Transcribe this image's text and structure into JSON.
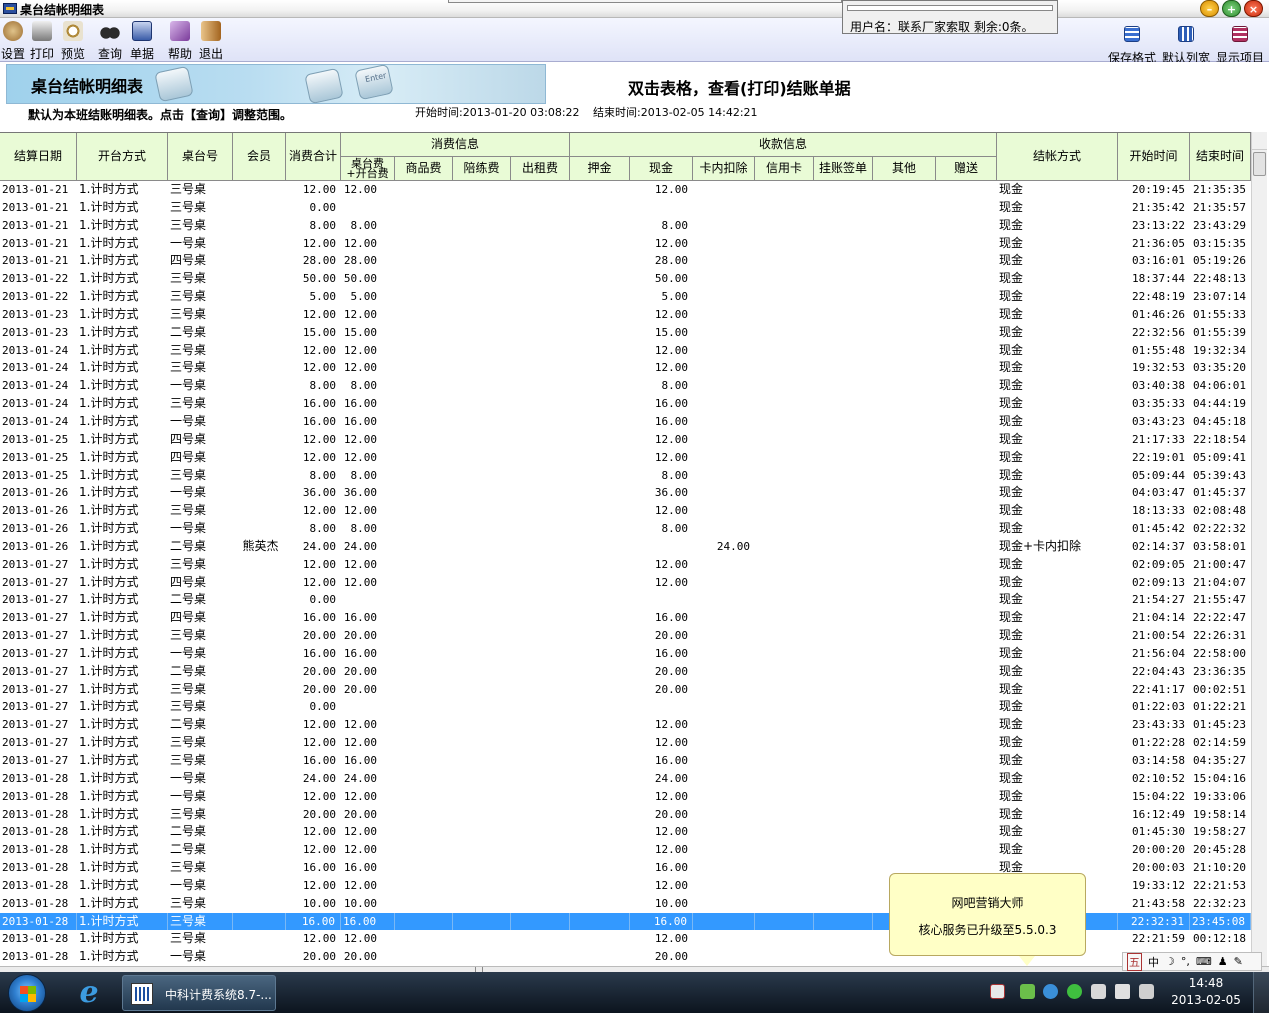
{
  "window": {
    "title": "桌台结帐明细表"
  },
  "user_panel": {
    "text": "用户名：联系厂家索取 剩余:0条。"
  },
  "toolbar": {
    "left": [
      {
        "id": "settings",
        "label": "设置",
        "icon": "gear-icon",
        "color": "#9a6b2f"
      },
      {
        "id": "print",
        "label": "打印",
        "icon": "printer-icon",
        "color": "#7a7a7a"
      },
      {
        "id": "preview",
        "label": "预览",
        "icon": "magnifier-icon",
        "color": "#b08a3a"
      },
      {
        "id": "query",
        "label": "查询",
        "icon": "binoculars-icon",
        "color": "#2b2b2b"
      },
      {
        "id": "bill",
        "label": "单据",
        "icon": "document-icon",
        "color": "#3a5ca8"
      },
      {
        "id": "help",
        "label": "帮助",
        "icon": "book-icon",
        "color": "#7a3a9a"
      },
      {
        "id": "exit",
        "label": "退出",
        "icon": "exit-door-icon",
        "color": "#a3641f"
      }
    ],
    "right": [
      {
        "id": "save-format",
        "label": "保存格式",
        "icon": "save-grid-icon",
        "color": "#3a6fd0"
      },
      {
        "id": "default-width",
        "label": "默认列宽",
        "icon": "columns-icon",
        "color": "#2f5fb8"
      },
      {
        "id": "show-items",
        "label": "显示项目",
        "icon": "list-icon",
        "color": "#b03060"
      }
    ]
  },
  "banner": {
    "title": "桌台结帐明细表",
    "keycap": "Enter",
    "headline": "双击表格，查看(打印)结账单据",
    "default_note": "默认为本班结账明细表。点击【查询】调整范围。",
    "start_time": "开始时间:2013-01-20 03:08:22",
    "end_time": "结束时间:2013-02-05 14:42:21"
  },
  "table": {
    "headers": {
      "date": "结算日期",
      "mode": "开台方式",
      "table": "桌台号",
      "member": "会员",
      "total": "消费合计",
      "consume_group": "消费信息",
      "table_fee": "桌台费+开台费",
      "goods": "商品费",
      "companion": "陪练费",
      "rent": "出租费",
      "receipt_group": "收款信息",
      "deposit": "押金",
      "cash": "现金",
      "card_deduct": "卡内扣除",
      "credit": "信用卡",
      "charge": "挂账签单",
      "other": "其他",
      "gift": "赠送",
      "settle": "结帐方式",
      "start": "开始时间",
      "end": "结束时间"
    },
    "rows": [
      [
        "2013-01-21",
        "1.计时方式",
        "三号桌",
        "",
        "12.00",
        "12.00",
        "",
        "",
        "",
        "",
        "12.00",
        "",
        "",
        "",
        "",
        "",
        "现金",
        "20:19:45",
        "21:35:35"
      ],
      [
        "2013-01-21",
        "1.计时方式",
        "三号桌",
        "",
        "0.00",
        "",
        "",
        "",
        "",
        "",
        "",
        "",
        "",
        "",
        "",
        "",
        "现金",
        "21:35:42",
        "21:35:57"
      ],
      [
        "2013-01-21",
        "1.计时方式",
        "三号桌",
        "",
        "8.00",
        "8.00",
        "",
        "",
        "",
        "",
        "8.00",
        "",
        "",
        "",
        "",
        "",
        "现金",
        "23:13:22",
        "23:43:29"
      ],
      [
        "2013-01-21",
        "1.计时方式",
        "一号桌",
        "",
        "12.00",
        "12.00",
        "",
        "",
        "",
        "",
        "12.00",
        "",
        "",
        "",
        "",
        "",
        "现金",
        "21:36:05",
        "03:15:35"
      ],
      [
        "2013-01-21",
        "1.计时方式",
        "四号桌",
        "",
        "28.00",
        "28.00",
        "",
        "",
        "",
        "",
        "28.00",
        "",
        "",
        "",
        "",
        "",
        "现金",
        "03:16:01",
        "05:19:26"
      ],
      [
        "2013-01-22",
        "1.计时方式",
        "三号桌",
        "",
        "50.00",
        "50.00",
        "",
        "",
        "",
        "",
        "50.00",
        "",
        "",
        "",
        "",
        "",
        "现金",
        "18:37:44",
        "22:48:13"
      ],
      [
        "2013-01-22",
        "1.计时方式",
        "三号桌",
        "",
        "5.00",
        "5.00",
        "",
        "",
        "",
        "",
        "5.00",
        "",
        "",
        "",
        "",
        "",
        "现金",
        "22:48:19",
        "23:07:14"
      ],
      [
        "2013-01-23",
        "1.计时方式",
        "三号桌",
        "",
        "12.00",
        "12.00",
        "",
        "",
        "",
        "",
        "12.00",
        "",
        "",
        "",
        "",
        "",
        "现金",
        "01:46:26",
        "01:55:33"
      ],
      [
        "2013-01-23",
        "1.计时方式",
        "二号桌",
        "",
        "15.00",
        "15.00",
        "",
        "",
        "",
        "",
        "15.00",
        "",
        "",
        "",
        "",
        "",
        "现金",
        "22:32:56",
        "01:55:39"
      ],
      [
        "2013-01-24",
        "1.计时方式",
        "三号桌",
        "",
        "12.00",
        "12.00",
        "",
        "",
        "",
        "",
        "12.00",
        "",
        "",
        "",
        "",
        "",
        "现金",
        "01:55:48",
        "19:32:34"
      ],
      [
        "2013-01-24",
        "1.计时方式",
        "三号桌",
        "",
        "12.00",
        "12.00",
        "",
        "",
        "",
        "",
        "12.00",
        "",
        "",
        "",
        "",
        "",
        "现金",
        "19:32:53",
        "03:35:20"
      ],
      [
        "2013-01-24",
        "1.计时方式",
        "一号桌",
        "",
        "8.00",
        "8.00",
        "",
        "",
        "",
        "",
        "8.00",
        "",
        "",
        "",
        "",
        "",
        "现金",
        "03:40:38",
        "04:06:01"
      ],
      [
        "2013-01-24",
        "1.计时方式",
        "三号桌",
        "",
        "16.00",
        "16.00",
        "",
        "",
        "",
        "",
        "16.00",
        "",
        "",
        "",
        "",
        "",
        "现金",
        "03:35:33",
        "04:44:19"
      ],
      [
        "2013-01-24",
        "1.计时方式",
        "一号桌",
        "",
        "16.00",
        "16.00",
        "",
        "",
        "",
        "",
        "16.00",
        "",
        "",
        "",
        "",
        "",
        "现金",
        "03:43:23",
        "04:45:18"
      ],
      [
        "2013-01-25",
        "1.计时方式",
        "四号桌",
        "",
        "12.00",
        "12.00",
        "",
        "",
        "",
        "",
        "12.00",
        "",
        "",
        "",
        "",
        "",
        "现金",
        "21:17:33",
        "22:18:54"
      ],
      [
        "2013-01-25",
        "1.计时方式",
        "四号桌",
        "",
        "12.00",
        "12.00",
        "",
        "",
        "",
        "",
        "12.00",
        "",
        "",
        "",
        "",
        "",
        "现金",
        "22:19:01",
        "05:09:41"
      ],
      [
        "2013-01-25",
        "1.计时方式",
        "三号桌",
        "",
        "8.00",
        "8.00",
        "",
        "",
        "",
        "",
        "8.00",
        "",
        "",
        "",
        "",
        "",
        "现金",
        "05:09:44",
        "05:39:43"
      ],
      [
        "2013-01-26",
        "1.计时方式",
        "一号桌",
        "",
        "36.00",
        "36.00",
        "",
        "",
        "",
        "",
        "36.00",
        "",
        "",
        "",
        "",
        "",
        "现金",
        "04:03:47",
        "01:45:37"
      ],
      [
        "2013-01-26",
        "1.计时方式",
        "三号桌",
        "",
        "12.00",
        "12.00",
        "",
        "",
        "",
        "",
        "12.00",
        "",
        "",
        "",
        "",
        "",
        "现金",
        "18:13:33",
        "02:08:48"
      ],
      [
        "2013-01-26",
        "1.计时方式",
        "一号桌",
        "",
        "8.00",
        "8.00",
        "",
        "",
        "",
        "",
        "8.00",
        "",
        "",
        "",
        "",
        "",
        "现金",
        "01:45:42",
        "02:22:32"
      ],
      [
        "2013-01-26",
        "1.计时方式",
        "二号桌",
        "熊英杰",
        "24.00",
        "24.00",
        "",
        "",
        "",
        "",
        "",
        "24.00",
        "",
        "",
        "",
        "",
        "现金+卡内扣除",
        "02:14:37",
        "03:58:01"
      ],
      [
        "2013-01-27",
        "1.计时方式",
        "三号桌",
        "",
        "12.00",
        "12.00",
        "",
        "",
        "",
        "",
        "12.00",
        "",
        "",
        "",
        "",
        "",
        "现金",
        "02:09:05",
        "21:00:47"
      ],
      [
        "2013-01-27",
        "1.计时方式",
        "四号桌",
        "",
        "12.00",
        "12.00",
        "",
        "",
        "",
        "",
        "12.00",
        "",
        "",
        "",
        "",
        "",
        "现金",
        "02:09:13",
        "21:04:07"
      ],
      [
        "2013-01-27",
        "1.计时方式",
        "二号桌",
        "",
        "0.00",
        "",
        "",
        "",
        "",
        "",
        "",
        "",
        "",
        "",
        "",
        "",
        "现金",
        "21:54:27",
        "21:55:47"
      ],
      [
        "2013-01-27",
        "1.计时方式",
        "四号桌",
        "",
        "16.00",
        "16.00",
        "",
        "",
        "",
        "",
        "16.00",
        "",
        "",
        "",
        "",
        "",
        "现金",
        "21:04:14",
        "22:22:47"
      ],
      [
        "2013-01-27",
        "1.计时方式",
        "三号桌",
        "",
        "20.00",
        "20.00",
        "",
        "",
        "",
        "",
        "20.00",
        "",
        "",
        "",
        "",
        "",
        "现金",
        "21:00:54",
        "22:26:31"
      ],
      [
        "2013-01-27",
        "1.计时方式",
        "一号桌",
        "",
        "16.00",
        "16.00",
        "",
        "",
        "",
        "",
        "16.00",
        "",
        "",
        "",
        "",
        "",
        "现金",
        "21:56:04",
        "22:58:00"
      ],
      [
        "2013-01-27",
        "1.计时方式",
        "二号桌",
        "",
        "20.00",
        "20.00",
        "",
        "",
        "",
        "",
        "20.00",
        "",
        "",
        "",
        "",
        "",
        "现金",
        "22:04:43",
        "23:36:35"
      ],
      [
        "2013-01-27",
        "1.计时方式",
        "三号桌",
        "",
        "20.00",
        "20.00",
        "",
        "",
        "",
        "",
        "20.00",
        "",
        "",
        "",
        "",
        "",
        "现金",
        "22:41:17",
        "00:02:51"
      ],
      [
        "2013-01-27",
        "1.计时方式",
        "三号桌",
        "",
        "0.00",
        "",
        "",
        "",
        "",
        "",
        "",
        "",
        "",
        "",
        "",
        "",
        "现金",
        "01:22:03",
        "01:22:21"
      ],
      [
        "2013-01-27",
        "1.计时方式",
        "二号桌",
        "",
        "12.00",
        "12.00",
        "",
        "",
        "",
        "",
        "12.00",
        "",
        "",
        "",
        "",
        "",
        "现金",
        "23:43:33",
        "01:45:23"
      ],
      [
        "2013-01-27",
        "1.计时方式",
        "三号桌",
        "",
        "12.00",
        "12.00",
        "",
        "",
        "",
        "",
        "12.00",
        "",
        "",
        "",
        "",
        "",
        "现金",
        "01:22:28",
        "02:14:59"
      ],
      [
        "2013-01-27",
        "1.计时方式",
        "三号桌",
        "",
        "16.00",
        "16.00",
        "",
        "",
        "",
        "",
        "16.00",
        "",
        "",
        "",
        "",
        "",
        "现金",
        "03:14:58",
        "04:35:27"
      ],
      [
        "2013-01-28",
        "1.计时方式",
        "一号桌",
        "",
        "24.00",
        "24.00",
        "",
        "",
        "",
        "",
        "24.00",
        "",
        "",
        "",
        "",
        "",
        "现金",
        "02:10:52",
        "15:04:16"
      ],
      [
        "2013-01-28",
        "1.计时方式",
        "一号桌",
        "",
        "12.00",
        "12.00",
        "",
        "",
        "",
        "",
        "12.00",
        "",
        "",
        "",
        "",
        "",
        "现金",
        "15:04:22",
        "19:33:06"
      ],
      [
        "2013-01-28",
        "1.计时方式",
        "三号桌",
        "",
        "20.00",
        "20.00",
        "",
        "",
        "",
        "",
        "20.00",
        "",
        "",
        "",
        "",
        "",
        "现金",
        "16:12:49",
        "19:58:14"
      ],
      [
        "2013-01-28",
        "1.计时方式",
        "二号桌",
        "",
        "12.00",
        "12.00",
        "",
        "",
        "",
        "",
        "12.00",
        "",
        "",
        "",
        "",
        "",
        "现金",
        "01:45:30",
        "19:58:27"
      ],
      [
        "2013-01-28",
        "1.计时方式",
        "二号桌",
        "",
        "12.00",
        "12.00",
        "",
        "",
        "",
        "",
        "12.00",
        "",
        "",
        "",
        "",
        "",
        "现金",
        "20:00:20",
        "20:45:28"
      ],
      [
        "2013-01-28",
        "1.计时方式",
        "三号桌",
        "",
        "16.00",
        "16.00",
        "",
        "",
        "",
        "",
        "16.00",
        "",
        "",
        "",
        "",
        "",
        "现金",
        "20:00:03",
        "21:10:20"
      ],
      [
        "2013-01-28",
        "1.计时方式",
        "一号桌",
        "",
        "12.00",
        "12.00",
        "",
        "",
        "",
        "",
        "12.00",
        "",
        "",
        "",
        "",
        "",
        "",
        "19:33:12",
        "22:21:53"
      ],
      [
        "2013-01-28",
        "1.计时方式",
        "三号桌",
        "",
        "10.00",
        "10.00",
        "",
        "",
        "",
        "",
        "10.00",
        "",
        "",
        "",
        "",
        "",
        "",
        "21:43:58",
        "22:32:23"
      ],
      [
        "2013-01-28",
        "1.计时方式",
        "三号桌",
        "",
        "16.00",
        "16.00",
        "",
        "",
        "",
        "",
        "16.00",
        "",
        "",
        "",
        "",
        "",
        "",
        "22:32:31",
        "23:45:08"
      ],
      [
        "2013-01-28",
        "1.计时方式",
        "三号桌",
        "",
        "12.00",
        "12.00",
        "",
        "",
        "",
        "",
        "12.00",
        "",
        "",
        "",
        "",
        "",
        "",
        "22:21:59",
        "00:12:18"
      ],
      [
        "2013-01-28",
        "1.计时方式",
        "一号桌",
        "",
        "20.00",
        "20.00",
        "",
        "",
        "",
        "",
        "20.00",
        "",
        "",
        "",
        "",
        "",
        "",
        "",
        ""
      ]
    ],
    "selected_row": 41
  },
  "notification": {
    "line1": "网吧营销大师",
    "line2": "核心服务已升级至5.5.0.3"
  },
  "ime": {
    "mode": "五",
    "lang": "中"
  },
  "taskbar": {
    "task_label": "中科计费系统8.7-...",
    "time": "14:48",
    "date": "2013-02-05"
  }
}
